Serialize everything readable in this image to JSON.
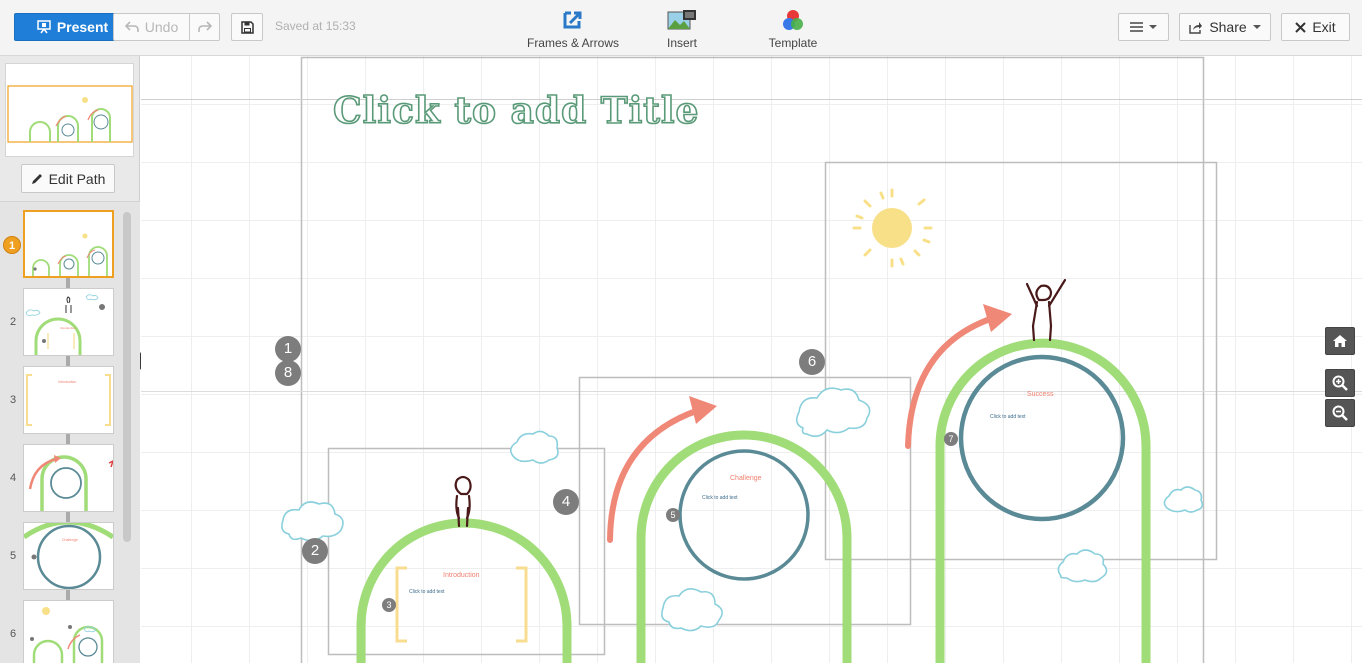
{
  "toolbar": {
    "present_label": "Present",
    "undo_label": "Undo",
    "saved_status": "Saved at 15:33",
    "tools": [
      {
        "label": "Frames & Arrows",
        "icon": "frames-arrows-icon"
      },
      {
        "label": "Insert",
        "icon": "insert-image-icon"
      },
      {
        "label": "Template",
        "icon": "template-circles-icon"
      }
    ],
    "share_label": "Share",
    "exit_label": "Exit"
  },
  "sidebar": {
    "edit_path_label": "Edit Path",
    "thumbnails": [
      {
        "number": "1",
        "active": true
      },
      {
        "number": "2",
        "active": false
      },
      {
        "number": "3",
        "active": false
      },
      {
        "number": "4",
        "active": false
      },
      {
        "number": "5",
        "active": false
      },
      {
        "number": "6",
        "active": false
      }
    ]
  },
  "canvas": {
    "title_placeholder": "Click to add Title",
    "path_markers": [
      "1",
      "8",
      "2",
      "4",
      "6",
      "3",
      "5",
      "7"
    ],
    "stage_headings": [
      "Introduction",
      "Challenge",
      "Success"
    ],
    "body_placeholder": "Click to add text"
  },
  "colors": {
    "accent_blue": "#1f7fd8",
    "active_orange": "#f0a020",
    "hill_green": "#a0dc78",
    "ring_teal": "#5a8a96",
    "arrow_salmon": "#f08878",
    "sun_yellow": "#f8e088",
    "bracket_yellow": "#f8dc90",
    "cloud_blue": "#8ad0dc"
  }
}
